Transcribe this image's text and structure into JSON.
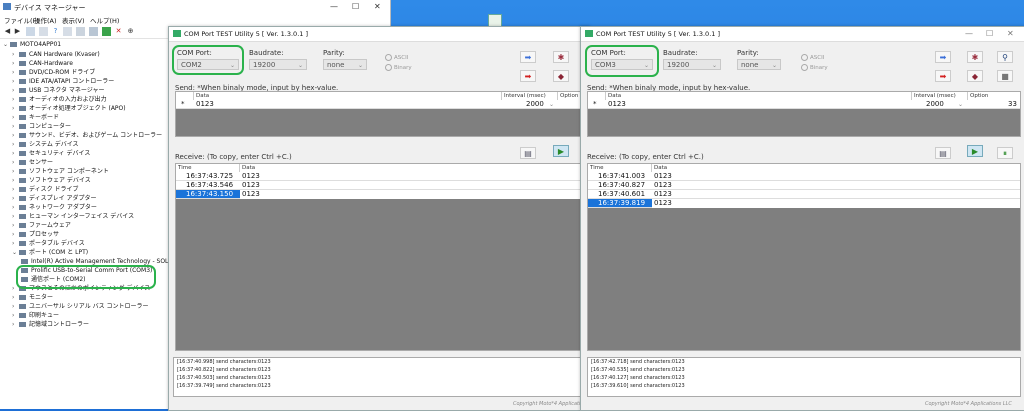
{
  "device_manager": {
    "title": "デバイス マネージャー",
    "menu": [
      "ファイル(F)",
      "操作(A)",
      "表示(V)",
      "ヘルプ(H)"
    ],
    "computer": "MOTO4APP01",
    "tree": [
      {
        "label": "CAN Hardware (Kvaser)",
        "expanded": false
      },
      {
        "label": "CAN-Hardware",
        "expanded": false
      },
      {
        "label": "DVD/CD-ROM ドライブ",
        "expanded": false
      },
      {
        "label": "IDE ATA/ATAPI コントローラー",
        "expanded": false
      },
      {
        "label": "USB コネクタ マネージャー",
        "expanded": false
      },
      {
        "label": "オーディオの入力および出力",
        "expanded": false
      },
      {
        "label": "オーディオ処理オブジェクト (APO)",
        "expanded": false
      },
      {
        "label": "キーボード",
        "expanded": false
      },
      {
        "label": "コンピューター",
        "expanded": false
      },
      {
        "label": "サウンド、ビデオ、およびゲーム コントローラー",
        "expanded": false
      },
      {
        "label": "システム デバイス",
        "expanded": false
      },
      {
        "label": "セキュリティ デバイス",
        "expanded": false
      },
      {
        "label": "センサー",
        "expanded": false
      },
      {
        "label": "ソフトウェア コンポーネント",
        "expanded": false
      },
      {
        "label": "ソフトウェア デバイス",
        "expanded": false
      },
      {
        "label": "ディスク ドライブ",
        "expanded": false
      },
      {
        "label": "ディスプレイ アダプター",
        "expanded": false
      },
      {
        "label": "ネットワーク アダプター",
        "expanded": false
      },
      {
        "label": "ヒューマン インターフェイス デバイス",
        "expanded": false
      },
      {
        "label": "ファームウェア",
        "expanded": false
      },
      {
        "label": "プロセッサ",
        "expanded": false
      },
      {
        "label": "ポータブル デバイス",
        "expanded": false
      },
      {
        "label": "ポート (COM と LPT)",
        "expanded": true
      }
    ],
    "ports_children": [
      "Intel(R) Active Management Technology - SOL (",
      "Prolific USB-to-Serial Comm Port (COM3)",
      "通信ポート (COM2)"
    ],
    "tree_after": [
      "マウスとそのほかのポインティング デバイス",
      "モニター",
      "ユニバーサル シリアル バス コントローラー",
      "印刷キュー",
      "記憶域コントローラー"
    ]
  },
  "left_util": {
    "title": "COM Port TEST Utility 5 [ Ver. 1.3.0.1 ]",
    "com_port_label": "COM Port:",
    "com_port_value": "COM2",
    "baudrate_label": "Baudrate:",
    "baudrate_value": "19200",
    "parity_label": "Parity:",
    "parity_value": "none",
    "radio_ascii": "ASCII",
    "radio_binary": "Binary",
    "send_label": "Send:  *When binaly mode, input by hex-value.",
    "send_headers": [
      "Data",
      "Interval (msec)",
      "Option"
    ],
    "send_row_marker": "*",
    "send_data": "0123",
    "send_interval": "2000",
    "receive_label": "Receive: (To copy, enter Ctrl +C.)",
    "recv_headers": [
      "Time",
      "Data"
    ],
    "recv_rows": [
      {
        "time": "16:37:43.725",
        "data": "0123"
      },
      {
        "time": "16:37:43.546",
        "data": "0123"
      },
      {
        "time": "16:37:43.150",
        "data": "0123"
      }
    ],
    "log": [
      "[16:37:40.998] send characters:0123",
      "[16:37:40.822] send characters:0123",
      "[16:37:40.503] send characters:0123",
      "[16:37:39.749] send characters:0123"
    ],
    "copyright": "Copyright Moto*4 Applicati"
  },
  "right_util": {
    "title": "COM Port TEST Utility 5 [ Ver. 1.3.0.1 ]",
    "com_port_label": "COM Port:",
    "com_port_value": "COM3",
    "baudrate_label": "Baudrate:",
    "baudrate_value": "19200",
    "parity_label": "Parity:",
    "parity_value": "none",
    "radio_ascii": "ASCII",
    "radio_binary": "Binary",
    "send_label": "Send:  *When binaly mode, input by hex-value.",
    "send_headers": [
      "Data",
      "Interval (msec)",
      "Option"
    ],
    "send_row_marker": "*",
    "send_data": "0123",
    "send_interval": "2000",
    "send_option": "33",
    "receive_label": "Receive: (To copy, enter Ctrl +C.)",
    "recv_headers": [
      "Time",
      "Data"
    ],
    "recv_rows": [
      {
        "time": "16:37:41.003",
        "data": "0123"
      },
      {
        "time": "16:37:40.827",
        "data": "0123"
      },
      {
        "time": "16:37:40.601",
        "data": "0123"
      },
      {
        "time": "16:37:39.819",
        "data": "0123"
      }
    ],
    "log": [
      "[16:37:42.718] send characters:0123",
      "[16:37:40.535] send characters:0123",
      "[16:37:40.127] send characters:0123",
      "[16:37:39.610] send characters:0123"
    ],
    "copyright": "Copyright Moto*4 Applications LLC"
  },
  "colors": {
    "highlight_green": "#2bb24c",
    "selected_blue": "#1a73d9",
    "send_arrow_blue": "#3b6fd8",
    "stop_red": "#d32020"
  }
}
